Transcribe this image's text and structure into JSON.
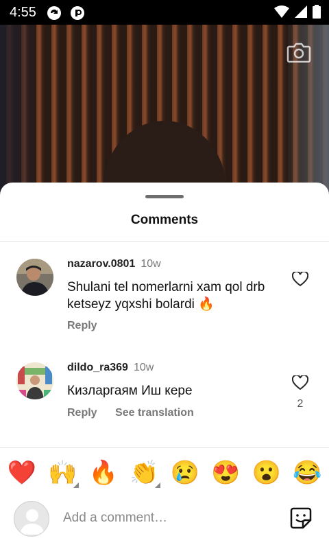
{
  "status_bar": {
    "time": "4:55"
  },
  "sheet": {
    "title": "Comments"
  },
  "comments": [
    {
      "username": "nazarov.0801",
      "age": "10w",
      "text": "Shulani tel nomerlarni xam qol drb ketseyz yqxshi bolardi 🔥",
      "actions": [
        "Reply"
      ],
      "likes": ""
    },
    {
      "username": "dildo_ra369",
      "age": "10w",
      "text": "Кизларгаям Иш кере",
      "actions": [
        "Reply",
        "See translation"
      ],
      "likes": "2"
    }
  ],
  "emoji_bar": [
    "❤️",
    "🙌",
    "🔥",
    "👏",
    "😢",
    "😍",
    "😮",
    "😂"
  ],
  "comment_input": {
    "placeholder": "Add a comment…"
  },
  "colors": {
    "sheet": "#ffffff",
    "muted_text": "#777777",
    "heart_outline": "#262626"
  }
}
